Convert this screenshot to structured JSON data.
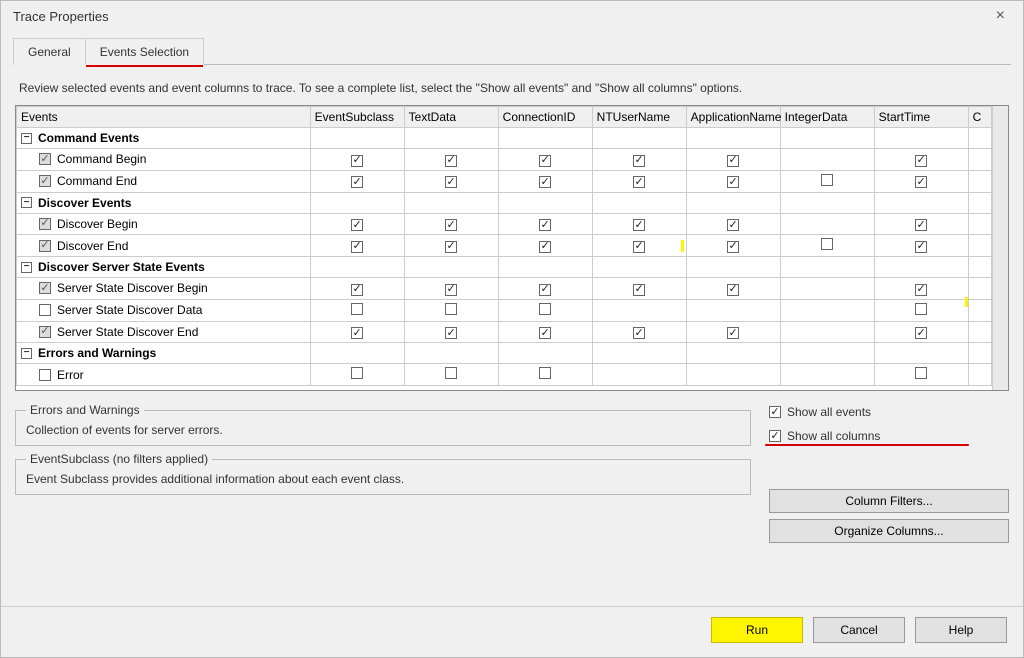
{
  "window": {
    "title": "Trace Properties"
  },
  "tabs": {
    "general": "General",
    "events": "Events Selection"
  },
  "instruction": "Review selected events and event columns to trace. To see a complete list, select the \"Show all events\" and \"Show all columns\" options.",
  "grid": {
    "columns": [
      "Events",
      "EventSubclass",
      "TextData",
      "ConnectionID",
      "NTUserName",
      "ApplicationName",
      "IntegerData",
      "StartTime",
      "C"
    ],
    "rows": [
      {
        "type": "group",
        "label": "Command Events"
      },
      {
        "type": "event",
        "label": "Command Begin",
        "row_cb": {
          "checked": true,
          "grey": true
        },
        "cells": {
          "EventSubclass": "on",
          "TextData": "on",
          "ConnectionID": "on",
          "NTUserName": "on",
          "ApplicationName": "on",
          "IntegerData": "",
          "StartTime": "on"
        }
      },
      {
        "type": "event",
        "label": "Command End",
        "row_cb": {
          "checked": true,
          "grey": true
        },
        "cells": {
          "EventSubclass": "on",
          "TextData": "on",
          "ConnectionID": "on",
          "NTUserName": "on",
          "ApplicationName": "on",
          "IntegerData": "off",
          "StartTime": "on"
        }
      },
      {
        "type": "group",
        "label": "Discover Events"
      },
      {
        "type": "event",
        "label": "Discover Begin",
        "row_cb": {
          "checked": true,
          "grey": true
        },
        "cells": {
          "EventSubclass": "on",
          "TextData": "on",
          "ConnectionID": "on",
          "NTUserName": "on",
          "ApplicationName": "on",
          "IntegerData": "",
          "StartTime": "on"
        }
      },
      {
        "type": "event",
        "label": "Discover End",
        "row_cb": {
          "checked": true,
          "grey": true
        },
        "cells": {
          "EventSubclass": "on",
          "TextData": "on",
          "ConnectionID": "on",
          "NTUserName": "on-cursor",
          "ApplicationName": "on",
          "IntegerData": "off",
          "StartTime": "on"
        }
      },
      {
        "type": "group",
        "label": "Discover Server State Events"
      },
      {
        "type": "event",
        "label": "Server State Discover Begin",
        "row_cb": {
          "checked": true,
          "grey": true
        },
        "cells": {
          "EventSubclass": "on",
          "TextData": "on",
          "ConnectionID": "on",
          "NTUserName": "on",
          "ApplicationName": "on",
          "IntegerData": "",
          "StartTime": "on"
        }
      },
      {
        "type": "event",
        "label": "Server State Discover Data",
        "row_cb": {
          "checked": false,
          "grey": false
        },
        "cells": {
          "EventSubclass": "off",
          "TextData": "off",
          "ConnectionID": "off",
          "NTUserName": "",
          "ApplicationName": "",
          "IntegerData": "",
          "StartTime": "off-corner"
        }
      },
      {
        "type": "event",
        "label": "Server State Discover End",
        "row_cb": {
          "checked": true,
          "grey": true
        },
        "cells": {
          "EventSubclass": "on",
          "TextData": "on",
          "ConnectionID": "on",
          "NTUserName": "on",
          "ApplicationName": "on",
          "IntegerData": "",
          "StartTime": "on"
        }
      },
      {
        "type": "group",
        "label": "Errors and Warnings"
      },
      {
        "type": "event",
        "label": "Error",
        "row_cb": {
          "checked": false,
          "grey": false
        },
        "cells": {
          "EventSubclass": "off",
          "TextData": "off",
          "ConnectionID": "off",
          "NTUserName": "",
          "ApplicationName": "",
          "IntegerData": "",
          "StartTime": "off"
        }
      }
    ]
  },
  "fieldsets": {
    "errors": {
      "legend": "Errors and Warnings",
      "text": "Collection of events for server errors."
    },
    "subclass": {
      "legend": "EventSubclass (no filters applied)",
      "text": "Event Subclass provides additional information about each event class."
    }
  },
  "checks": {
    "show_events": "Show all events",
    "show_columns": "Show all columns"
  },
  "buttons": {
    "column_filters": "Column Filters...",
    "organize_columns": "Organize Columns...",
    "run": "Run",
    "cancel": "Cancel",
    "help": "Help"
  }
}
